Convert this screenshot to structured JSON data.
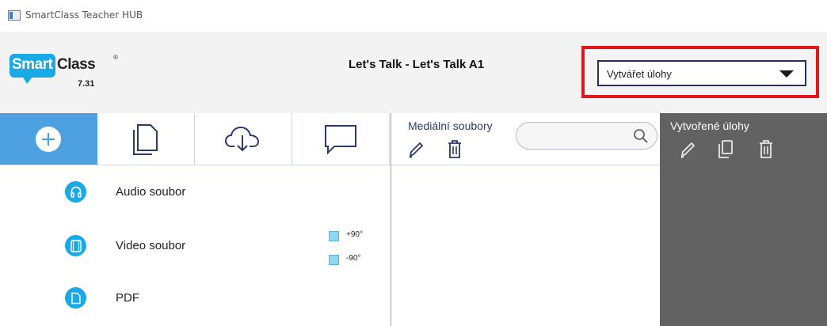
{
  "window": {
    "title": "SmartClass Teacher HUB"
  },
  "logo": {
    "smart": "Smart",
    "class": "Class",
    "registered": "®",
    "version": "7.31"
  },
  "header": {
    "title": "Let's Talk - Let's Talk A1"
  },
  "mode_select": {
    "value": "Vytvářet úlohy"
  },
  "toolbar": {
    "buttons": [
      {
        "icon": "add-icon",
        "active": true
      },
      {
        "icon": "document-icon",
        "active": false
      },
      {
        "icon": "cloud-download-icon",
        "active": false
      },
      {
        "icon": "chat-icon",
        "active": false
      }
    ]
  },
  "media_panel": {
    "title": "Mediální soubory",
    "search_value": ""
  },
  "created_panel": {
    "title": "Vytvořené úlohy"
  },
  "file_types": [
    {
      "label": "Audio soubor",
      "icon": "headphones-icon"
    },
    {
      "label": "Video soubor",
      "icon": "film-icon"
    },
    {
      "label": "PDF",
      "icon": "file-icon"
    }
  ],
  "rotation": {
    "plus": "+90°",
    "minus": "-90°"
  },
  "colors": {
    "accent": "#4ea1e0",
    "icon_blue": "#19a9e6",
    "highlight_red": "#e3161b",
    "panel_dark": "#626262"
  }
}
